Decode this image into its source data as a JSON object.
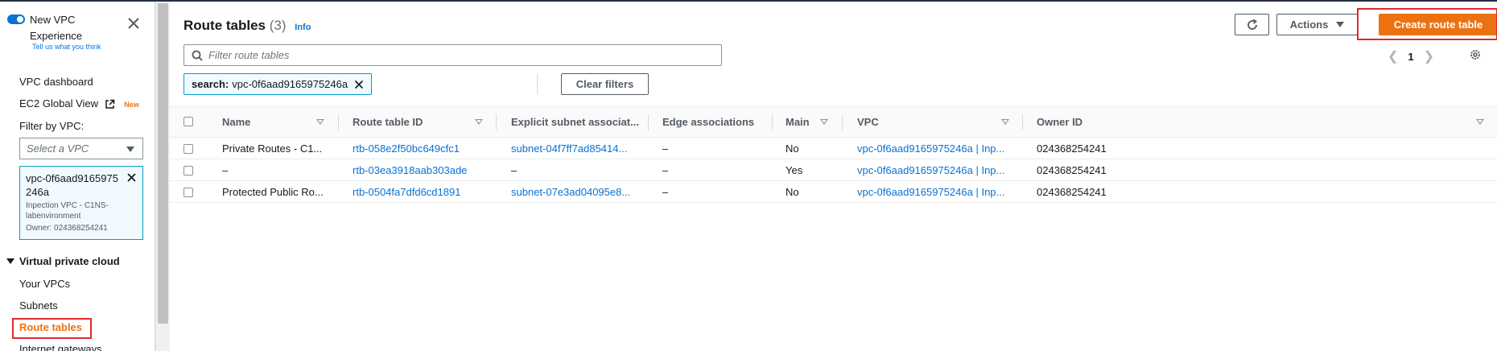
{
  "sidebar": {
    "new_vpc_label": "New VPC Experience",
    "feedback_link": "Tell us what you think",
    "nav": {
      "vpc_dashboard": "VPC dashboard",
      "ec2_global_view": "EC2 Global View",
      "new_badge": "New"
    },
    "filter_by_vpc_label": "Filter by VPC:",
    "vpc_select_placeholder": "Select a VPC",
    "selected_vpc": {
      "id": "vpc-0f6aad9165975246a",
      "name": "Inpection VPC - C1NS-labenvironment",
      "owner": "Owner: 024368254241"
    },
    "section_title": "Virtual private cloud",
    "section_items": [
      "Your VPCs",
      "Subnets",
      "Route tables",
      "Internet gateways"
    ],
    "active_item": "Route tables"
  },
  "header": {
    "title": "Route tables",
    "count": "(3)",
    "info_link": "Info",
    "actions_label": "Actions",
    "create_label": "Create route table"
  },
  "search": {
    "placeholder": "Filter route tables",
    "token_key": "search:",
    "token_value": "vpc-0f6aad9165975246a",
    "clear_filters_label": "Clear filters"
  },
  "pagination": {
    "current_page": "1"
  },
  "table": {
    "columns": [
      "Name",
      "Route table ID",
      "Explicit subnet associat...",
      "Edge associations",
      "Main",
      "VPC",
      "Owner ID"
    ],
    "rows": [
      {
        "name": "Private Routes - C1...",
        "route_table_id": "rtb-058e2f50bc649cfc1",
        "explicit_subnet": "subnet-04f7ff7ad85414...",
        "edge": "–",
        "main": "No",
        "vpc": "vpc-0f6aad9165975246a | Inp...",
        "owner": "024368254241"
      },
      {
        "name": "–",
        "route_table_id": "rtb-03ea3918aab303ade",
        "explicit_subnet": "–",
        "edge": "–",
        "main": "Yes",
        "vpc": "vpc-0f6aad9165975246a | Inp...",
        "owner": "024368254241"
      },
      {
        "name": "Protected Public Ro...",
        "route_table_id": "rtb-0504fa7dfd6cd1891",
        "explicit_subnet": "subnet-07e3ad04095e8...",
        "edge": "–",
        "main": "No",
        "vpc": "vpc-0f6aad9165975246a | Inp...",
        "owner": "024368254241"
      }
    ]
  },
  "colors": {
    "accent_orange": "#ec7211",
    "link_blue": "#0972d3",
    "highlight_red": "#e0282e"
  }
}
